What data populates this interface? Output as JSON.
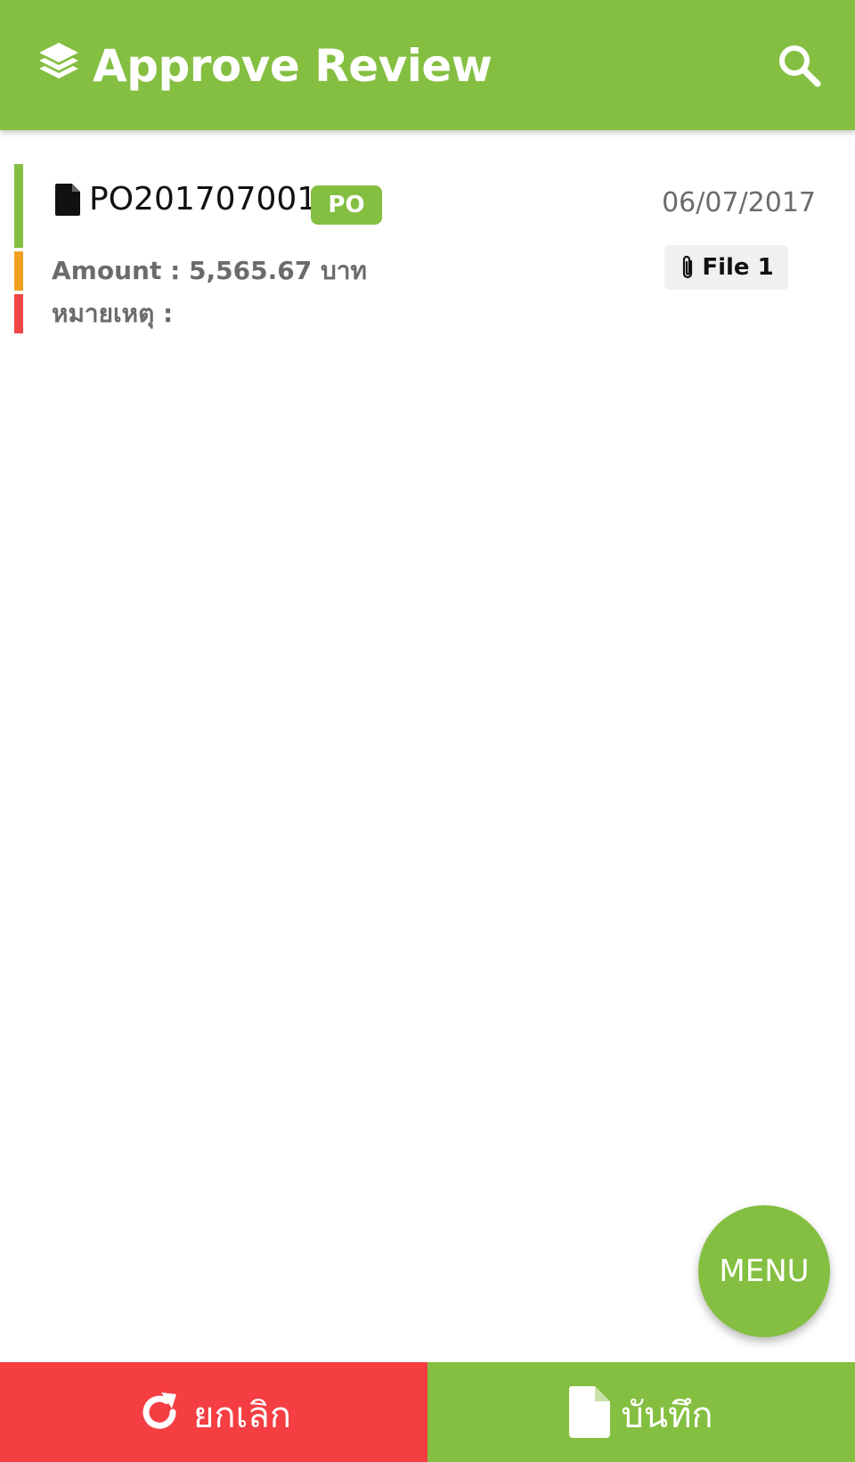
{
  "app_bar": {
    "title": "Approve Review",
    "left_icon": "layers-icon",
    "right_icon": "search-icon",
    "background": "#84bf41"
  },
  "document": {
    "icon": "document-icon",
    "number": "PO201707001",
    "type_badge": "PO",
    "date": "06/07/2017",
    "amount_text": "Amount : 5,565.67 บาท",
    "remark_text": "หมายเหตุ :",
    "attachment": {
      "icon": "paperclip-icon",
      "label": "File 1"
    },
    "status_colors": [
      "#84bf41",
      "#f0a020",
      "#f04545"
    ]
  },
  "fab": {
    "label": "MENU",
    "color": "#84bf41"
  },
  "bottom_bar": {
    "cancel": {
      "label": "ยกเลิก",
      "icon": "refresh-icon",
      "color": "#f43e42"
    },
    "save": {
      "label": "บันทึก",
      "icon": "file-icon",
      "color": "#84bf41"
    }
  }
}
